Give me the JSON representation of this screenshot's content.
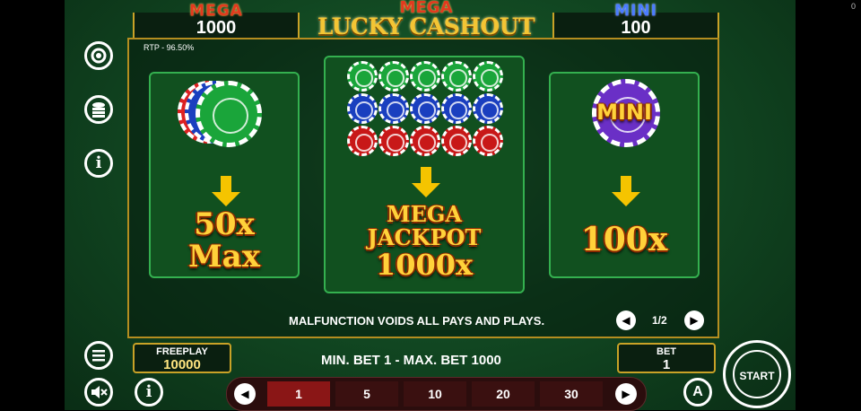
{
  "corner_value": "0",
  "jackpots": {
    "mega": {
      "title": "MEGA",
      "value": "1000"
    },
    "mini": {
      "title": "MINI",
      "value": "100"
    }
  },
  "game_title": {
    "line1": "MEGA",
    "line2": "LUCKY CASHOUT"
  },
  "rtp": "RTP - 96.50%",
  "cards": {
    "left": {
      "text1": "50x",
      "text2": "Max"
    },
    "center": {
      "line1": "MEGA",
      "line2": "JACKPOT",
      "line3": "1000x"
    },
    "right": {
      "chip_label": "MINI",
      "text": "100x"
    }
  },
  "malfunction_notice": "MALFUNCTION VOIDS ALL PAYS AND PLAYS.",
  "pagination": {
    "label": "1/2"
  },
  "freeplay": {
    "label": "FREEPLAY",
    "value": "10000"
  },
  "bet_range": "MIN. BET 1 - MAX. BET 1000",
  "bet": {
    "label": "BET",
    "value": "1"
  },
  "bet_options": [
    "1",
    "5",
    "10",
    "20",
    "30"
  ],
  "active_bet_index": 0,
  "start_label": "START",
  "auto_label": "A",
  "colors": {
    "felt": "#1f6b35",
    "gold": "#c9a227",
    "card_border": "#34b04f",
    "active_bet": "#8a1616"
  }
}
